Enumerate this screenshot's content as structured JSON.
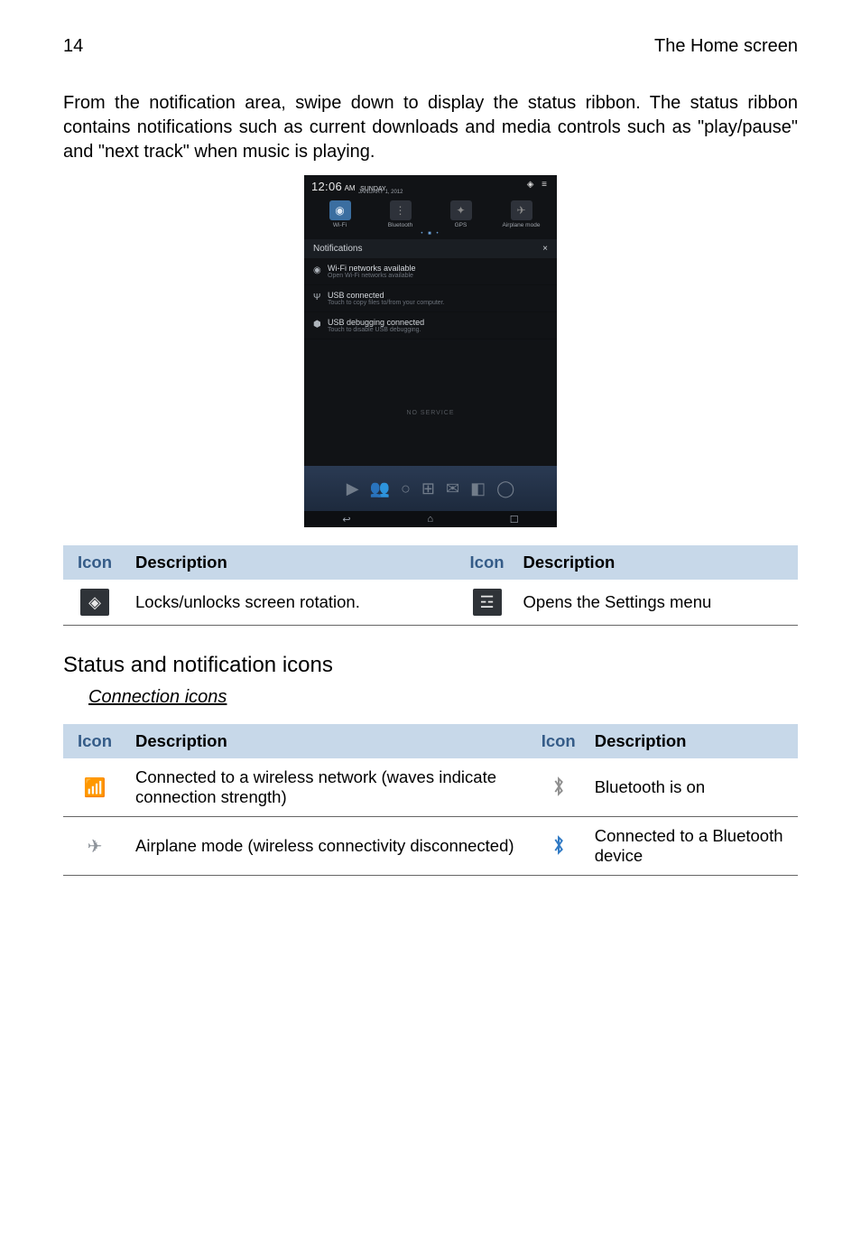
{
  "header": {
    "page_number": "14",
    "section_title": "The Home screen"
  },
  "intro": "From the  notification area, swipe down to display the status ribbon. The status ribbon contains notifications such as current downloads and media controls such as \"play/pause\" and \"next track\" when music is playing.",
  "screenshot": {
    "time": "12:06",
    "ampm": "AM",
    "day_top": "SUNDAY",
    "day_bottom": "JANUARY 1, 2012",
    "tiles": {
      "wifi": "Wi-Fi",
      "bluetooth": "Bluetooth",
      "gps": "GPS",
      "airplane": "Airplane mode"
    },
    "notif_header": "Notifications",
    "clear": "×",
    "n1_t": "Wi-Fi networks available",
    "n1_s": "Open Wi-Fi networks available",
    "n2_t": "USB connected",
    "n2_s": "Touch to copy files to/from your computer.",
    "n3_t": "USB debugging connected",
    "n3_s": "Touch to disable USB debugging.",
    "no_service": "NO SERVICE"
  },
  "table1": {
    "h_icon": "Icon",
    "h_desc": "Description",
    "r1_desc": "Locks/unlocks screen rotation.",
    "r1b_desc": "Opens the Settings menu"
  },
  "section_heading": "Status and notification icons",
  "subheading": "Connection icons",
  "table2": {
    "h_icon": "Icon",
    "h_desc": "Description",
    "r1a": "Connected to a wireless network (waves indicate connection strength)",
    "r1b": "Bluetooth is on",
    "r2a": "Airplane mode (wireless connectivity disconnected)",
    "r2b": "Connected to a Bluetooth device"
  }
}
